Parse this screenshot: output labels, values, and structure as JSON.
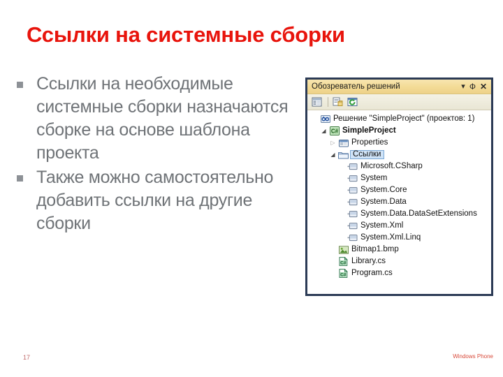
{
  "slide": {
    "title": "Ссылки на системные сборки",
    "title_color": "#E8140C",
    "page_number": "17",
    "footer": "Windows Phone"
  },
  "body": {
    "bullets": [
      "Ссылки на необходимые системные сборки назначаются сборке на основе шаблона проекта",
      "Также можно самостоятельно добавить ссылки на другие сборки"
    ]
  },
  "solution_explorer": {
    "title": "Обозреватель решений",
    "title_icons": {
      "dropdown": "▾",
      "pin": "Ф",
      "close": "✕"
    },
    "toolbar": {
      "buttons": [
        {
          "name": "properties-window-icon",
          "tooltip": "Properties Window"
        },
        {
          "name": "show-all-files-icon",
          "tooltip": "Show All Files"
        },
        {
          "name": "refresh-icon",
          "tooltip": "Refresh"
        }
      ]
    },
    "tree": [
      {
        "label": "Решение \"SimpleProject\"  (проектов: 1)",
        "indent": 0,
        "twisty": "none",
        "icon": "solution-icon",
        "bold": false,
        "selected": false
      },
      {
        "label": "SimpleProject",
        "indent": 1,
        "twisty": "expanded",
        "icon": "csharp-project-icon",
        "bold": true,
        "selected": false
      },
      {
        "label": "Properties",
        "indent": 2,
        "twisty": "collapsed",
        "icon": "properties-folder-icon",
        "bold": false,
        "selected": false
      },
      {
        "label": "Ссылки",
        "indent": 2,
        "twisty": "expanded",
        "icon": "references-folder-icon",
        "bold": false,
        "selected": true
      },
      {
        "label": "Microsoft.CSharp",
        "indent": 3,
        "twisty": "none",
        "icon": "reference-icon",
        "bold": false,
        "selected": false
      },
      {
        "label": "System",
        "indent": 3,
        "twisty": "none",
        "icon": "reference-icon",
        "bold": false,
        "selected": false
      },
      {
        "label": "System.Core",
        "indent": 3,
        "twisty": "none",
        "icon": "reference-icon",
        "bold": false,
        "selected": false
      },
      {
        "label": "System.Data",
        "indent": 3,
        "twisty": "none",
        "icon": "reference-icon",
        "bold": false,
        "selected": false
      },
      {
        "label": "System.Data.DataSetExtensions",
        "indent": 3,
        "twisty": "none",
        "icon": "reference-icon",
        "bold": false,
        "selected": false
      },
      {
        "label": "System.Xml",
        "indent": 3,
        "twisty": "none",
        "icon": "reference-icon",
        "bold": false,
        "selected": false
      },
      {
        "label": "System.Xml.Linq",
        "indent": 3,
        "twisty": "none",
        "icon": "reference-icon",
        "bold": false,
        "selected": false
      },
      {
        "label": "Bitmap1.bmp",
        "indent": 2,
        "twisty": "none",
        "icon": "bitmap-file-icon",
        "bold": false,
        "selected": false
      },
      {
        "label": "Library.cs",
        "indent": 2,
        "twisty": "none",
        "icon": "csharp-file-icon",
        "bold": false,
        "selected": false
      },
      {
        "label": "Program.cs",
        "indent": 2,
        "twisty": "none",
        "icon": "csharp-file-icon",
        "bold": false,
        "selected": false
      }
    ]
  }
}
